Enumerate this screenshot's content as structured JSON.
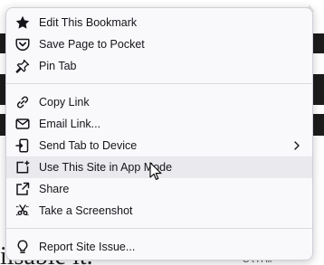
{
  "menu": {
    "items": [
      {
        "label": "Edit This Bookmark",
        "icon": "star-icon"
      },
      {
        "label": "Save Page to Pocket",
        "icon": "pocket-icon"
      },
      {
        "label": "Pin Tab",
        "icon": "pin-icon"
      },
      {
        "label": "Copy Link",
        "icon": "link-icon"
      },
      {
        "label": "Email Link...",
        "icon": "envelope-icon"
      },
      {
        "label": "Send Tab to Device",
        "icon": "send-to-device-icon"
      },
      {
        "label": "Use This Site in App Mode",
        "icon": "app-mode-icon"
      },
      {
        "label": "Share",
        "icon": "share-icon"
      },
      {
        "label": "Take a Screenshot",
        "icon": "screenshot-icon"
      },
      {
        "label": "Report Site Issue...",
        "icon": "lightbulb-icon"
      }
    ]
  },
  "background": {
    "heading_fragment": "iisable it.",
    "side_text": "C    t H    ill"
  }
}
